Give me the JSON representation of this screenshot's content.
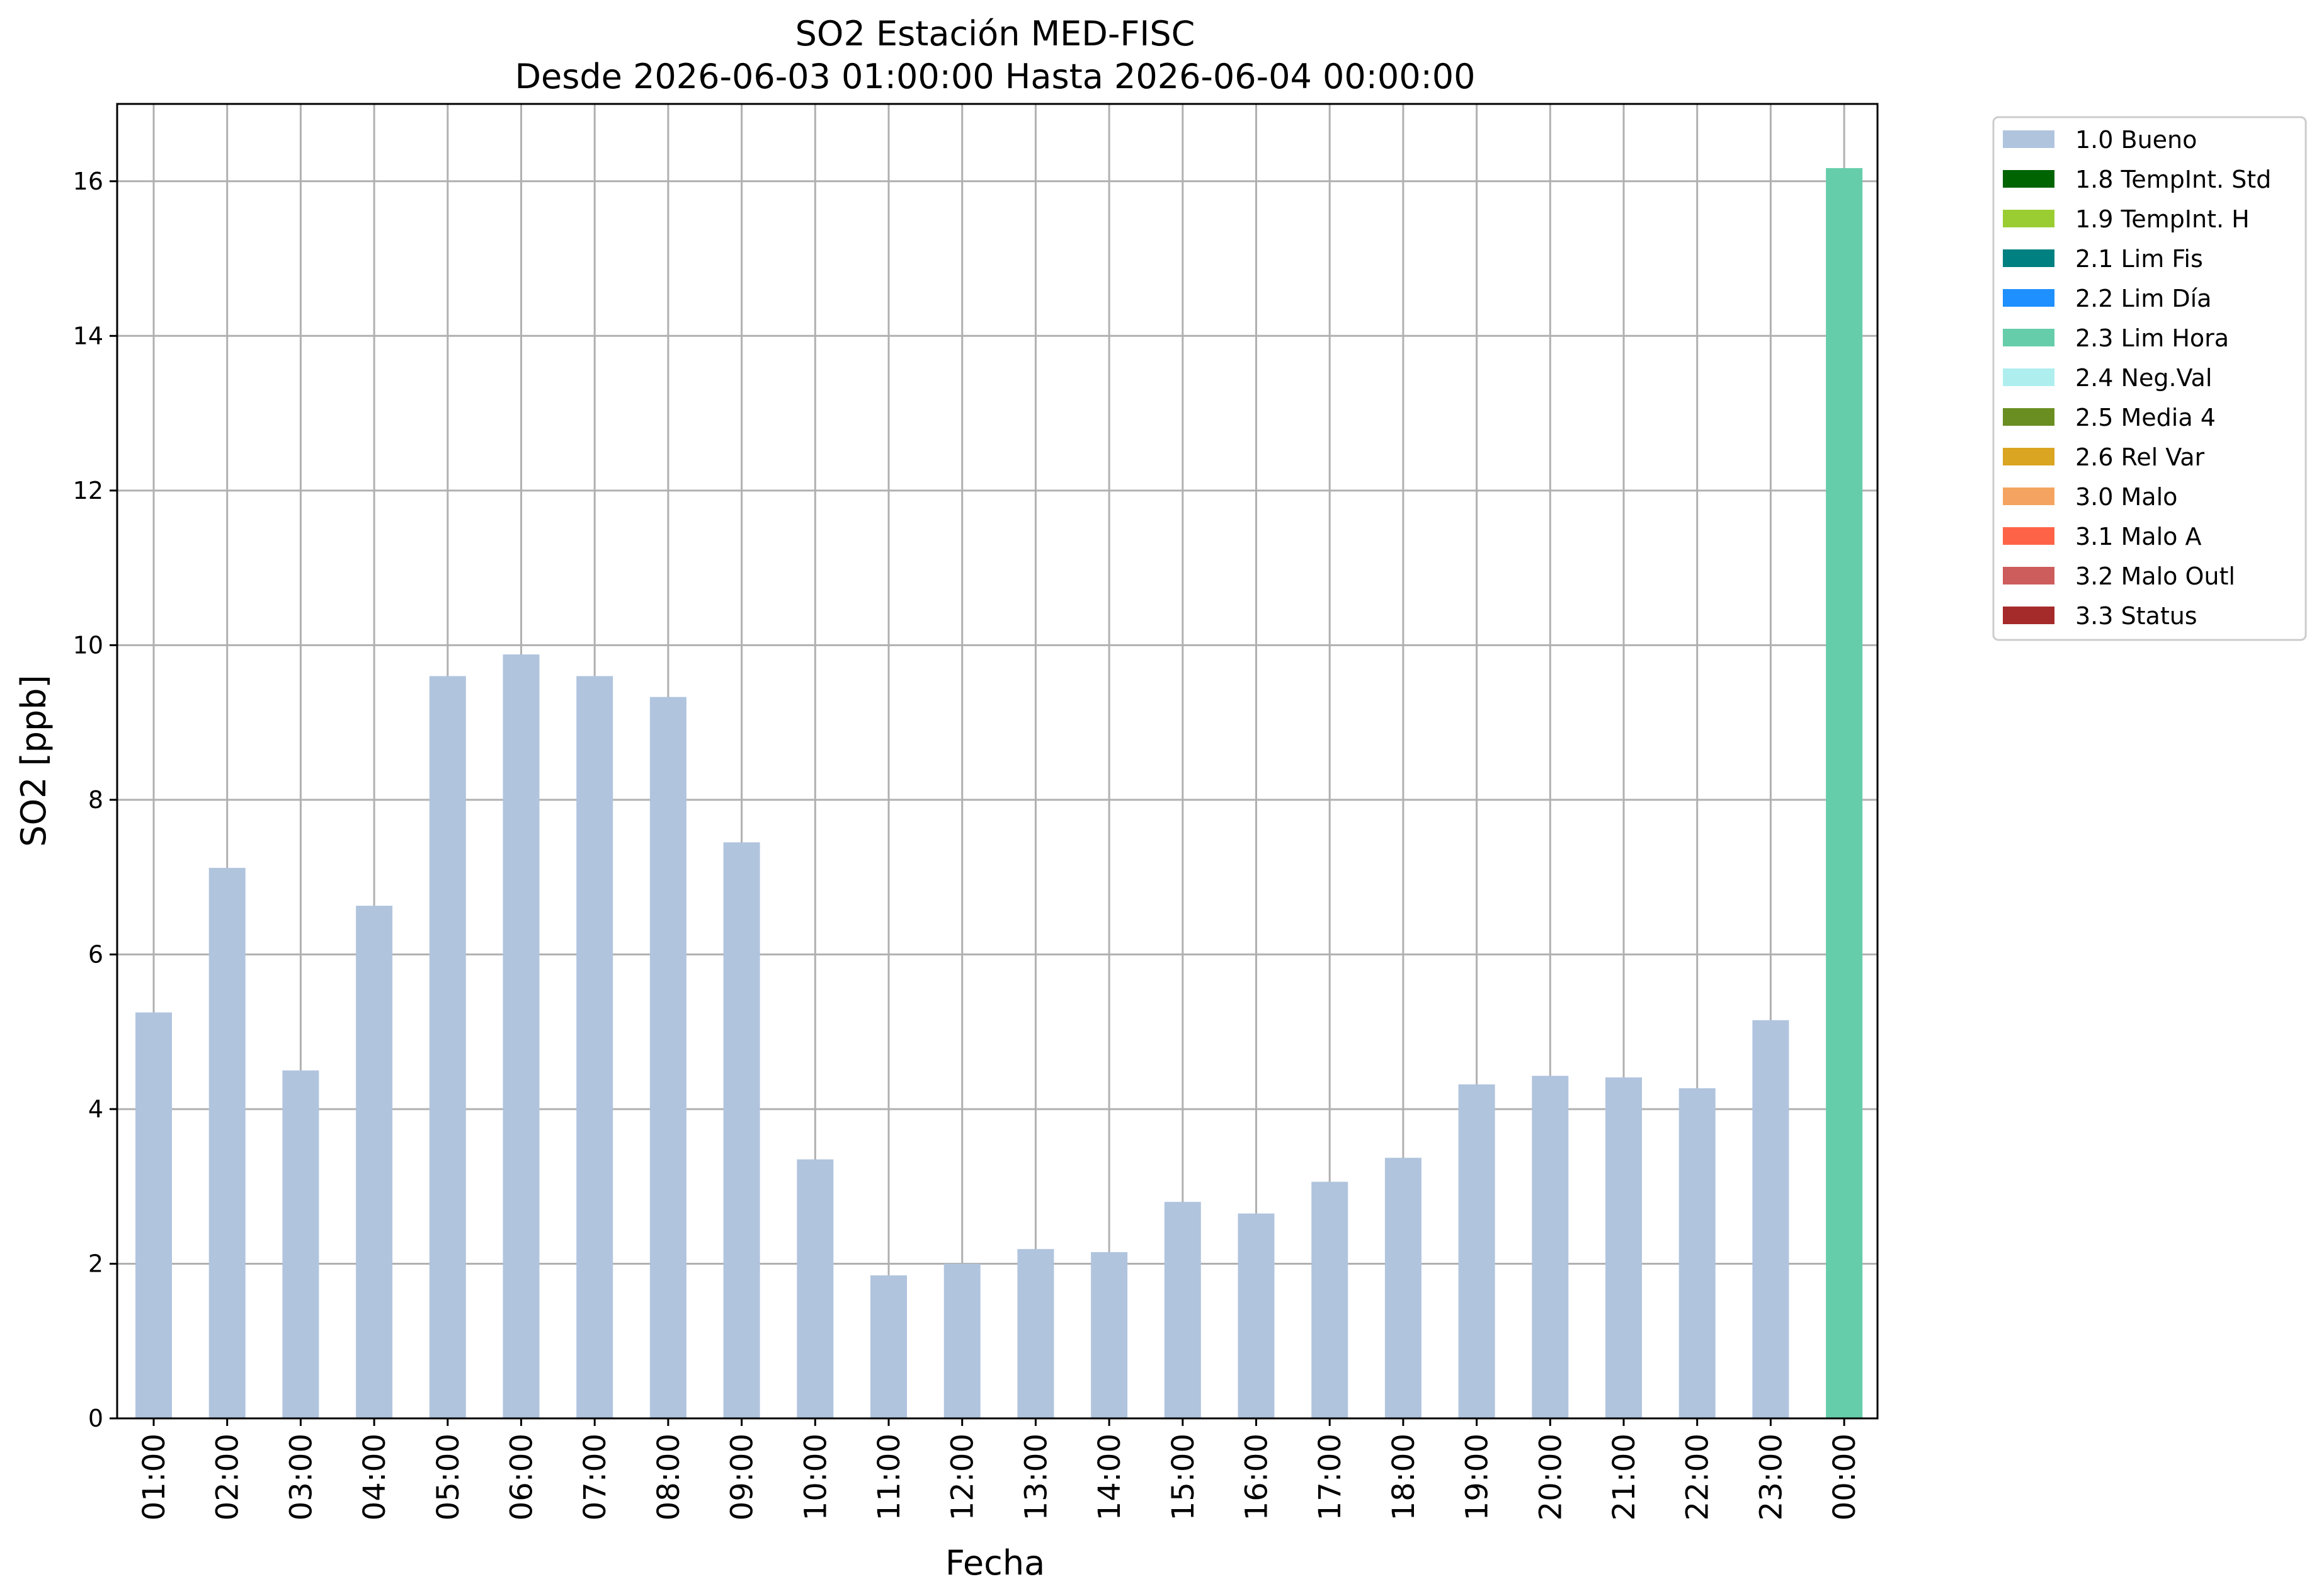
{
  "chart_data": {
    "type": "bar",
    "title": "SO2 Estación MED-FISC",
    "subtitle": "Desde 2026-06-03 01:00:00 Hasta 2026-06-04 00:00:00",
    "xlabel": "Fecha",
    "ylabel": "SO2 [ppb]",
    "ylim": [
      0,
      17
    ],
    "yticks": [
      0,
      2,
      4,
      6,
      8,
      10,
      12,
      14,
      16
    ],
    "grid": true,
    "legend_position": "outside-top-right",
    "categories": [
      "01:00",
      "02:00",
      "03:00",
      "04:00",
      "05:00",
      "06:00",
      "07:00",
      "08:00",
      "09:00",
      "10:00",
      "11:00",
      "12:00",
      "13:00",
      "14:00",
      "15:00",
      "16:00",
      "17:00",
      "18:00",
      "19:00",
      "20:00",
      "21:00",
      "22:00",
      "23:00",
      "00:00"
    ],
    "values": [
      5.25,
      7.12,
      4.5,
      6.63,
      9.6,
      9.88,
      9.6,
      9.33,
      7.45,
      3.35,
      1.85,
      2.0,
      2.19,
      2.15,
      2.8,
      2.65,
      3.06,
      3.37,
      4.32,
      4.43,
      4.41,
      4.27,
      5.15,
      16.17
    ],
    "flags": [
      "1.0 Bueno",
      "1.0 Bueno",
      "1.0 Bueno",
      "1.0 Bueno",
      "1.0 Bueno",
      "1.0 Bueno",
      "1.0 Bueno",
      "1.0 Bueno",
      "1.0 Bueno",
      "1.0 Bueno",
      "1.0 Bueno",
      "1.0 Bueno",
      "1.0 Bueno",
      "1.0 Bueno",
      "1.0 Bueno",
      "1.0 Bueno",
      "1.0 Bueno",
      "1.0 Bueno",
      "1.0 Bueno",
      "1.0 Bueno",
      "1.0 Bueno",
      "1.0 Bueno",
      "1.0 Bueno",
      "2.3 Lim Hora"
    ],
    "legend": [
      {
        "label": "1.0 Bueno",
        "color": "#b0c4de"
      },
      {
        "label": "1.8 TempInt. Std",
        "color": "#006400"
      },
      {
        "label": "1.9 TempInt. H",
        "color": "#9acd32"
      },
      {
        "label": "2.1 Lim Fis",
        "color": "#008080"
      },
      {
        "label": "2.2 Lim Día",
        "color": "#1e90ff"
      },
      {
        "label": "2.3 Lim Hora",
        "color": "#66cdaa"
      },
      {
        "label": "2.4 Neg.Val",
        "color": "#afeeee"
      },
      {
        "label": "2.5 Media 4",
        "color": "#6b8e23"
      },
      {
        "label": "2.6 Rel Var",
        "color": "#daa520"
      },
      {
        "label": "3.0 Malo",
        "color": "#f4a460"
      },
      {
        "label": "3.1 Malo A",
        "color": "#ff6347"
      },
      {
        "label": "3.2 Malo Outl",
        "color": "#cd5c5c"
      },
      {
        "label": "3.3 Status",
        "color": "#a52a2a"
      }
    ]
  }
}
